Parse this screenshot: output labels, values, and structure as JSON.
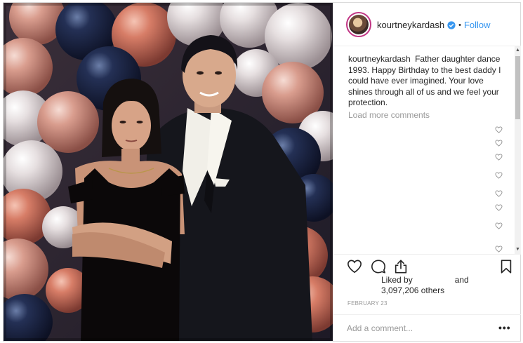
{
  "post": {
    "username": "kourtneykardash",
    "follow_label": "Follow",
    "dot": "•",
    "caption_user": "kourtneykardash",
    "caption_text": "Father daughter dance 1993. Happy Birthday to the best daddy I could have ever imagined. Your love shines through all of us and we feel your protection.",
    "load_more": "Load more comments",
    "liked_by": "Liked by",
    "liked_and": "and",
    "likes_count": "3,097,206 others",
    "date": "FEBRUARY 23",
    "add_comment_placeholder": "Add a comment...",
    "more_label": "•••"
  },
  "icons": {
    "verified": "verified-badge-icon",
    "like": "heart-icon",
    "comment": "comment-icon",
    "share": "share-icon",
    "save": "bookmark-icon",
    "comment_like": "small-heart-icon"
  },
  "colors": {
    "link_blue": "#3897f0",
    "text": "#262626",
    "muted": "#999999",
    "border": "#dbdbdb"
  }
}
